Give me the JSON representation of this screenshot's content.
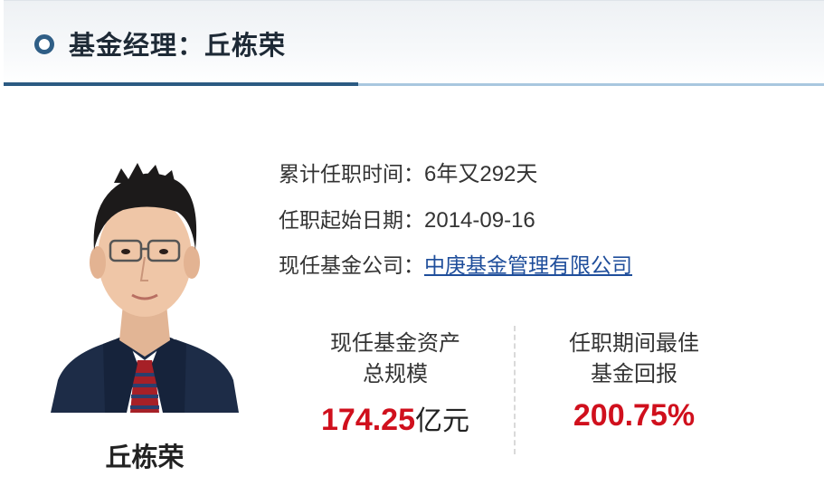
{
  "header": {
    "title": "基金经理：丘栋荣"
  },
  "manager": {
    "name": "丘栋荣"
  },
  "info": {
    "tenure_label": "累计任职时间：",
    "tenure_value": "6年又292天",
    "start_label": "任职起始日期：",
    "start_value": "2014-09-16",
    "company_label": "现任基金公司：",
    "company_value": "中庚基金管理有限公司"
  },
  "stats": {
    "assets_label_line1": "现任基金资产",
    "assets_label_line2": "总规模",
    "assets_value": "174.25",
    "assets_unit": "亿元",
    "return_label_line1": "任职期间最佳",
    "return_label_line2": "基金回报",
    "return_value": "200.75%"
  },
  "colors": {
    "accent_blue": "#2b5a82",
    "highlight_red": "#d0101d",
    "link_blue": "#1f4e9b"
  },
  "icons": {
    "header": "circle-bullet-icon"
  }
}
